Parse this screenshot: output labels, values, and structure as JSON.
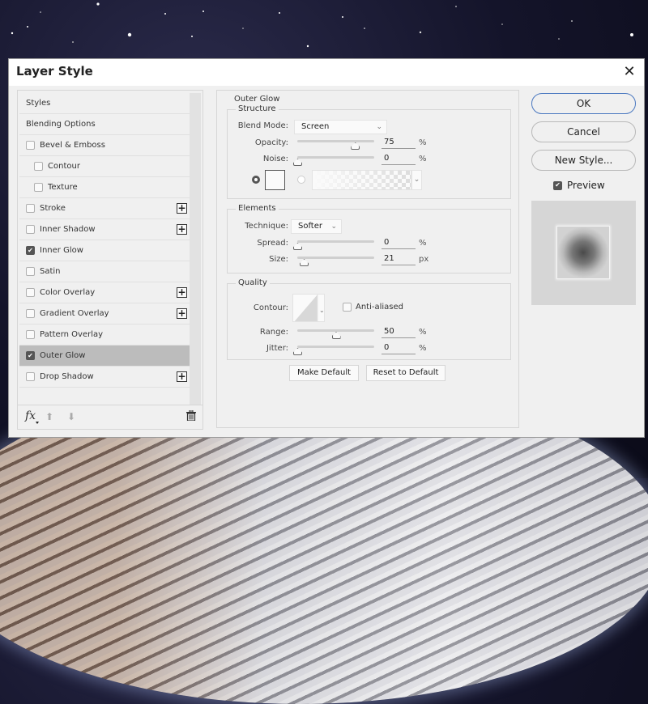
{
  "dialog": {
    "title": "Layer Style",
    "close_icon": "close-icon"
  },
  "layer_list": {
    "items": [
      {
        "label": "Styles",
        "checkbox": false,
        "checked": false,
        "plus": false,
        "indent": false,
        "selected": false
      },
      {
        "label": "Blending Options",
        "checkbox": false,
        "checked": false,
        "plus": false,
        "indent": false,
        "selected": false
      },
      {
        "label": "Bevel & Emboss",
        "checkbox": true,
        "checked": false,
        "plus": false,
        "indent": false,
        "selected": false
      },
      {
        "label": "Contour",
        "checkbox": true,
        "checked": false,
        "plus": false,
        "indent": true,
        "selected": false
      },
      {
        "label": "Texture",
        "checkbox": true,
        "checked": false,
        "plus": false,
        "indent": true,
        "selected": false
      },
      {
        "label": "Stroke",
        "checkbox": true,
        "checked": false,
        "plus": true,
        "indent": false,
        "selected": false
      },
      {
        "label": "Inner Shadow",
        "checkbox": true,
        "checked": false,
        "plus": true,
        "indent": false,
        "selected": false
      },
      {
        "label": "Inner Glow",
        "checkbox": true,
        "checked": true,
        "plus": false,
        "indent": false,
        "selected": false
      },
      {
        "label": "Satin",
        "checkbox": true,
        "checked": false,
        "plus": false,
        "indent": false,
        "selected": false
      },
      {
        "label": "Color Overlay",
        "checkbox": true,
        "checked": false,
        "plus": true,
        "indent": false,
        "selected": false
      },
      {
        "label": "Gradient Overlay",
        "checkbox": true,
        "checked": false,
        "plus": true,
        "indent": false,
        "selected": false
      },
      {
        "label": "Pattern Overlay",
        "checkbox": true,
        "checked": false,
        "plus": false,
        "indent": false,
        "selected": false
      },
      {
        "label": "Outer Glow",
        "checkbox": true,
        "checked": true,
        "plus": false,
        "indent": false,
        "selected": true
      },
      {
        "label": "Drop Shadow",
        "checkbox": true,
        "checked": false,
        "plus": true,
        "indent": false,
        "selected": false
      }
    ],
    "footer": {
      "fx_label": "fx",
      "move_up_icon": "⬆",
      "move_down_icon": "⬇",
      "delete_icon": "🗑"
    }
  },
  "outer_glow": {
    "title": "Outer Glow",
    "structure": {
      "title": "Structure",
      "blend_mode_label": "Blend Mode:",
      "blend_mode_value": "Screen",
      "opacity_label": "Opacity:",
      "opacity_value": "75",
      "opacity_percent": 75,
      "opacity_unit": "%",
      "noise_label": "Noise:",
      "noise_value": "0",
      "noise_percent": 0,
      "noise_unit": "%",
      "color_mode": "solid",
      "glow_color": "#fafafa"
    },
    "elements": {
      "title": "Elements",
      "technique_label": "Technique:",
      "technique_value": "Softer",
      "spread_label": "Spread:",
      "spread_value": "0",
      "spread_percent": 0,
      "spread_unit": "%",
      "size_label": "Size:",
      "size_value": "21",
      "size_fraction": 0.085,
      "size_unit": "px"
    },
    "quality": {
      "title": "Quality",
      "contour_label": "Contour:",
      "anti_aliased_label": "Anti-aliased",
      "anti_aliased": false,
      "range_label": "Range:",
      "range_value": "50",
      "range_percent": 50,
      "range_unit": "%",
      "jitter_label": "Jitter:",
      "jitter_value": "0",
      "jitter_percent": 0,
      "jitter_unit": "%"
    },
    "make_default_label": "Make Default",
    "reset_default_label": "Reset to Default"
  },
  "actions": {
    "ok_label": "OK",
    "cancel_label": "Cancel",
    "new_style_label": "New Style...",
    "preview_label": "Preview",
    "preview_checked": true
  },
  "colors": {
    "dialog_bg": "#f0f0f0",
    "selected_row": "#bcbcbc",
    "primary_border": "#4a78c0"
  }
}
